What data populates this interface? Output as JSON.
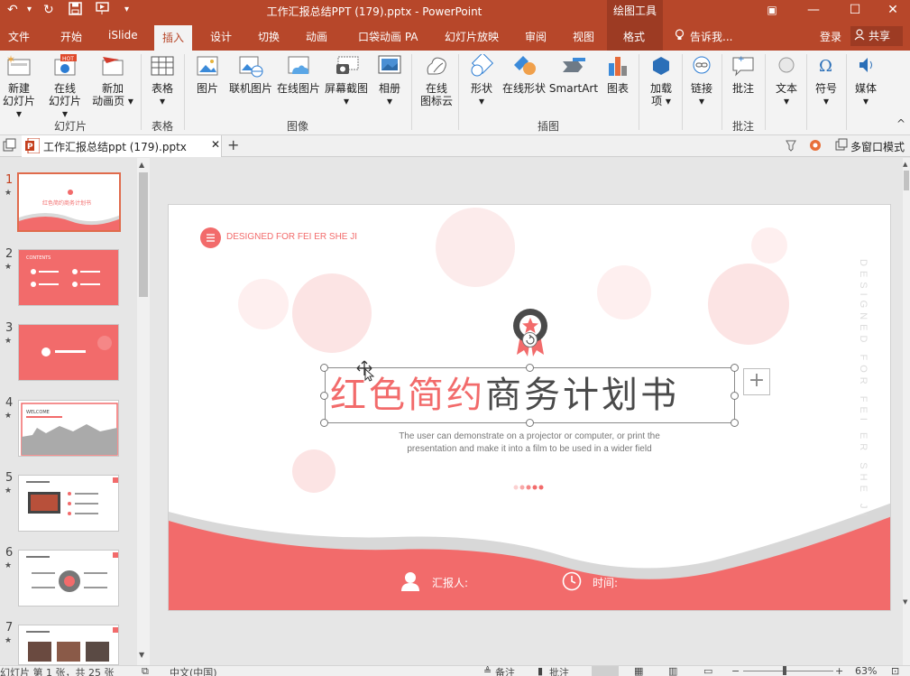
{
  "window": {
    "title": "工作汇报总结PPT (179).pptx - PowerPoint",
    "context_tab_group": "绘图工具",
    "controls": {
      "ribbon_options": "▣",
      "minimize": "—",
      "maximize": "☐",
      "close": "✕"
    }
  },
  "quick_access": {
    "undo": "↶",
    "undo_dropdown": "▾",
    "redo": "↻",
    "save": "💾",
    "present": "▢",
    "customize": "▾"
  },
  "tabs": [
    {
      "label": "文件"
    },
    {
      "label": "开始"
    },
    {
      "label": "iSlide"
    },
    {
      "label": "插入",
      "active": true
    },
    {
      "label": "设计"
    },
    {
      "label": "切换"
    },
    {
      "label": "动画"
    },
    {
      "label": "口袋动画 PA"
    },
    {
      "label": "幻灯片放映"
    },
    {
      "label": "审阅"
    },
    {
      "label": "视图"
    },
    {
      "label": "格式"
    }
  ],
  "tell_me": "告诉我...",
  "account": {
    "login": "登录",
    "share": "共享"
  },
  "ribbon": {
    "groups": [
      {
        "label": "幻灯片"
      },
      {
        "label": "表格"
      },
      {
        "label": "图像"
      },
      {
        "label": "插图"
      },
      {
        "label": "批注"
      }
    ],
    "buttons": {
      "new_slide": [
        "新建",
        "幻灯片 ▾"
      ],
      "online_slide": [
        "在线",
        "幻灯片 ▾"
      ],
      "add_anim_page": [
        "新加",
        "动画页 ▾"
      ],
      "table": [
        "表格",
        "▾"
      ],
      "picture": [
        "图片"
      ],
      "linked_picture": [
        "联机图片"
      ],
      "online_picture": [
        "在线图片"
      ],
      "screenshot": [
        "屏幕截图",
        "▾"
      ],
      "album": [
        "相册",
        "▾"
      ],
      "icon_cloud": [
        "在线",
        "图标云"
      ],
      "shapes": [
        "形状",
        "▾"
      ],
      "online_shapes": [
        "在线形状"
      ],
      "smartart": [
        "SmartArt"
      ],
      "chart": [
        "图表"
      ],
      "addins": [
        "加载",
        "项 ▾"
      ],
      "link": [
        "链接",
        "▾"
      ],
      "comment": [
        "批注"
      ],
      "text": [
        "文本",
        "▾"
      ],
      "symbol": [
        "符号",
        "▾"
      ],
      "media": [
        "媒体",
        "▾"
      ]
    },
    "collapse": "^"
  },
  "doc_tab": {
    "title": "工作汇报总结ppt (179).pptx",
    "close": "✕",
    "add": "+",
    "multi_window": "多窗口模式"
  },
  "slides": [
    {
      "num": "1",
      "current": true
    },
    {
      "num": "2"
    },
    {
      "num": "3"
    },
    {
      "num": "4"
    },
    {
      "num": "5"
    },
    {
      "num": "6"
    },
    {
      "num": "7"
    }
  ],
  "slide": {
    "designed_label": "DESIGNED FOR FEI ER SHE JI",
    "vertical_text": "DESIGNED FOR FEI ER SHE JI",
    "title_red": "红色简约",
    "title_dark": "商务计划书",
    "subtitle_line1": "The user can demonstrate on a projector or computer, or print the",
    "subtitle_line2": "presentation and make it into a film to be used in a wider field",
    "reporter_label": "汇报人:",
    "time_label": "时间:",
    "plus": "+"
  },
  "thumb_texts": {
    "t1_title": "红色简约商务计划书",
    "t2_title": "CONTENTS",
    "t4_title": "WELCOME"
  },
  "status": {
    "slide_info": "幻灯片 第 1 张，共 25 张",
    "language": "中文(中国)",
    "notes": "备注",
    "comments": "批注",
    "zoom": "63%"
  },
  "colors": {
    "accent": "#b7472a",
    "slide_red": "#f26b6b",
    "text_dark": "#4a4a4a"
  }
}
